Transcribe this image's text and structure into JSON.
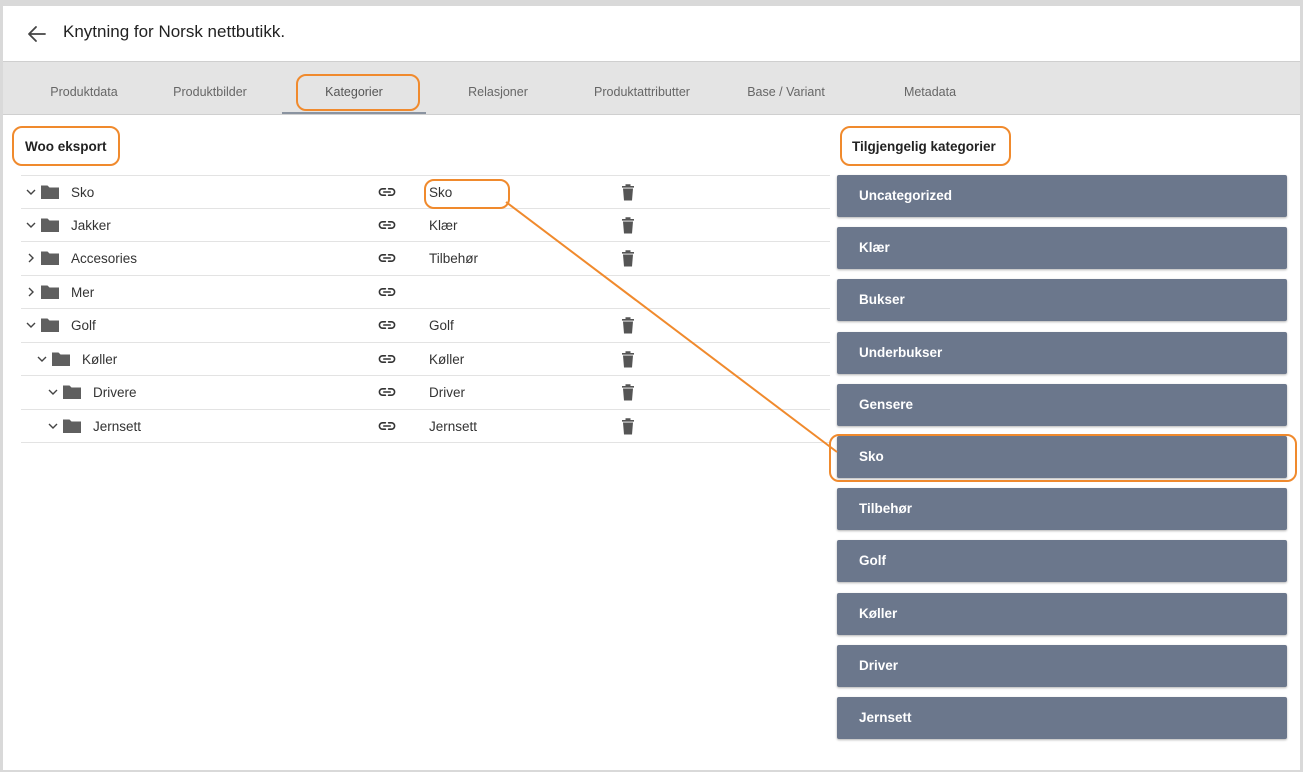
{
  "header": {
    "title": "Knytning for Norsk nettbutikk."
  },
  "tabs": [
    {
      "label": "Produktdata"
    },
    {
      "label": "Produktbilder"
    },
    {
      "label": "Kategorier"
    },
    {
      "label": "Relasjoner"
    },
    {
      "label": "Produktattributter"
    },
    {
      "label": "Base / Variant"
    },
    {
      "label": "Metadata"
    }
  ],
  "active_tab": "Kategorier",
  "left": {
    "title": "Woo eksport",
    "rows": [
      {
        "name": "Sko",
        "expanded": true,
        "mapped": "Sko"
      },
      {
        "name": "Jakker",
        "expanded": true,
        "mapped": "Klær"
      },
      {
        "name": "Accesories",
        "expanded": false,
        "mapped": "Tilbehør"
      },
      {
        "name": "Mer",
        "expanded": false,
        "mapped": ""
      },
      {
        "name": "Golf",
        "expanded": true,
        "mapped": "Golf"
      },
      {
        "name": "Køller",
        "expanded": true,
        "mapped": "Køller"
      },
      {
        "name": "Drivere",
        "expanded": true,
        "mapped": "Driver"
      },
      {
        "name": "Jernsett",
        "expanded": true,
        "mapped": "Jernsett"
      }
    ]
  },
  "right": {
    "title": "Tilgjengelig kategorier",
    "categories": [
      "Uncategorized",
      "Klær",
      "Bukser",
      "Underbukser",
      "Gensere",
      "Sko",
      "Tilbehør",
      "Golf",
      "Køller",
      "Driver",
      "Jernsett"
    ]
  },
  "colors": {
    "highlight": "#f08a2d",
    "category_bg": "#6b778c",
    "icon": "#555555"
  },
  "icons": {
    "back": "arrow-left-icon",
    "folder": "folder-icon",
    "link": "link-icon",
    "trash": "trash-icon",
    "chevron_down": "chevron-down-icon",
    "chevron_right": "chevron-right-icon"
  }
}
